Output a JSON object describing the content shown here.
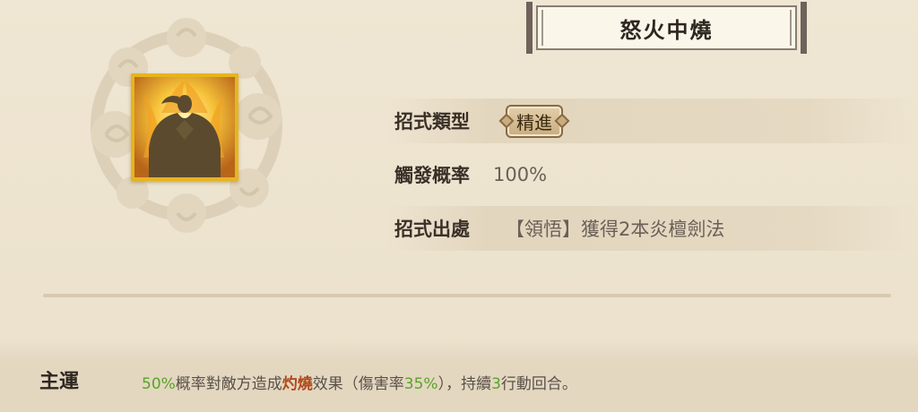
{
  "skill": {
    "name": "怒火中燒",
    "icon": "flame-meditation-icon"
  },
  "info": {
    "type_label": "招式類型",
    "type_value": "精進",
    "trigger_label": "觸發概率",
    "trigger_value": "100%",
    "source_label": "招式出處",
    "source_value": "【領悟】獲得2本炎檀劍法"
  },
  "effect": {
    "label": "主運",
    "p1": "50%",
    "p2": "概率對敵方造成",
    "p3": "灼燒",
    "p4": "效果（傷害率",
    "p5": "35%",
    "p6": "），持續",
    "p7": "3",
    "p8": "行動回合。"
  },
  "colors": {
    "background": "#ede3cf",
    "highlight_green": "#5aa32a",
    "highlight_red": "#b04a1c",
    "icon_border": "#e8b41e"
  }
}
